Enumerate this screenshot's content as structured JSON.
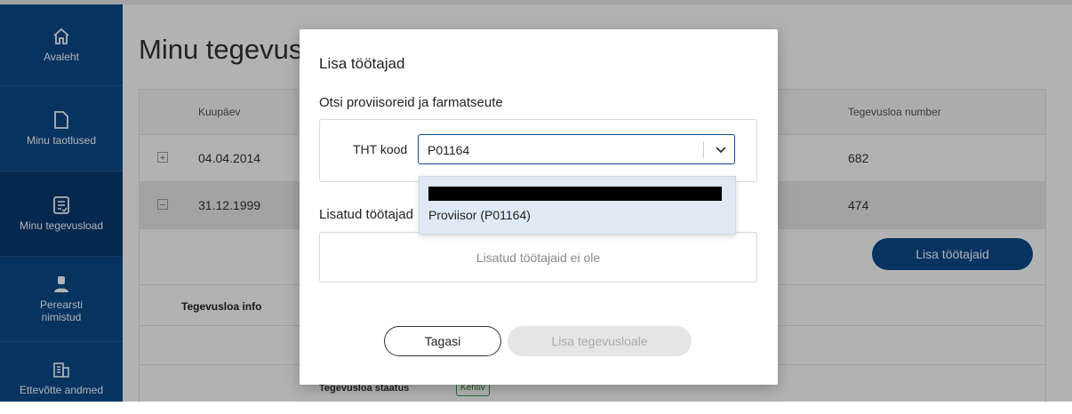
{
  "sidebar": {
    "items": [
      {
        "label": "Avaleht",
        "icon": "home-icon"
      },
      {
        "label": "Minu taotlused",
        "icon": "document-icon"
      },
      {
        "label": "Minu tegevusload",
        "icon": "license-icon"
      },
      {
        "label": "Perearsti nimistud",
        "icon": "doctor-icon"
      },
      {
        "label": "Ettevõtte andmed",
        "icon": "building-icon"
      }
    ]
  },
  "page": {
    "title": "Minu tegevusload"
  },
  "table": {
    "headers": {
      "date": "Kuupäev",
      "license_number": "Tegevusloa number"
    },
    "rows": [
      {
        "date": "04.04.2014",
        "number": "682",
        "expander": "+"
      },
      {
        "date": "31.12.1999",
        "number": "474",
        "expander": "−"
      }
    ],
    "add_employees_label": "Lisa töötajaid",
    "info_label": "Tegevusloa info",
    "status_label": "Tegevusloa staatus",
    "status_value": "Kehtiv"
  },
  "modal": {
    "title": "Lisa töötajad",
    "search_heading": "Otsi proviisoreid ja farmatseute",
    "tht_label": "THT kood",
    "tht_value": "P01164",
    "added_heading": "Lisatud töötajad",
    "added_empty": "Lisatud töötajaid ei ole",
    "back_label": "Tagasi",
    "add_label": "Lisa tegevusloale"
  },
  "dropdown": {
    "options": [
      "Proviisor (P01164)"
    ]
  },
  "colors": {
    "primary": "#0b4a8c",
    "sidebar_active": "#083a72",
    "badge": "#2e9e4a"
  }
}
